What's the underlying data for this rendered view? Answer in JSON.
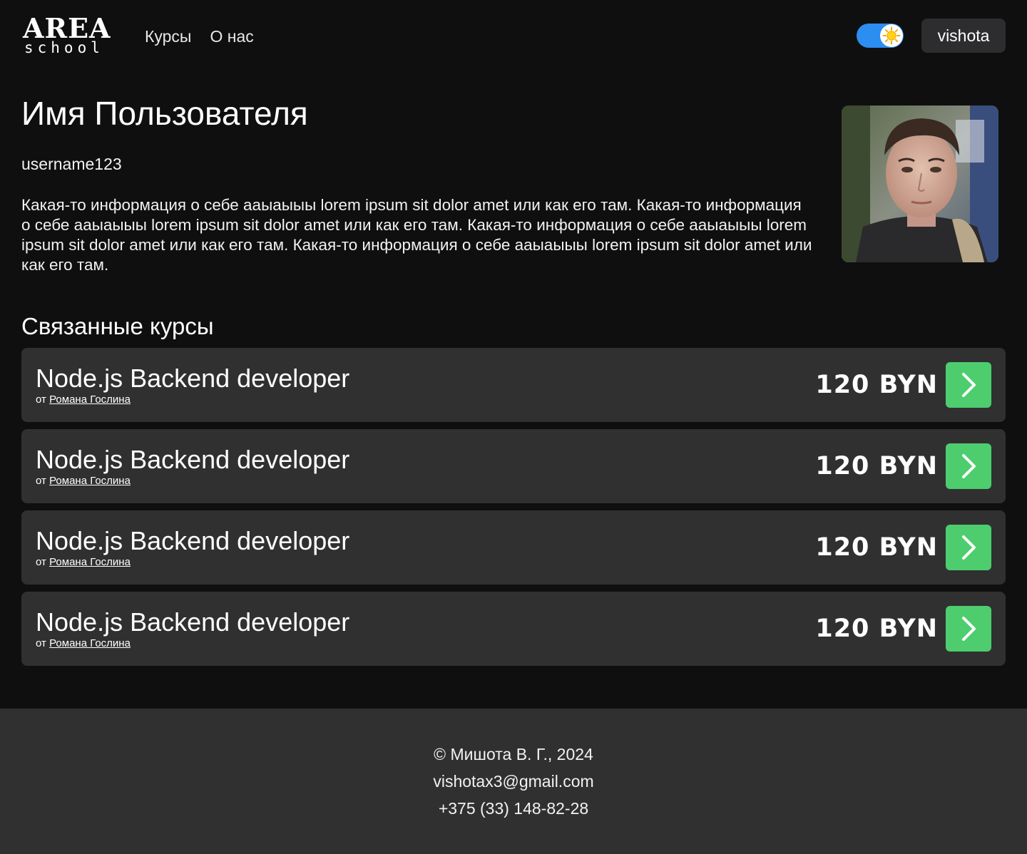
{
  "header": {
    "logo": {
      "line1": "AREA",
      "line2": "school"
    },
    "nav": [
      {
        "label": "Курсы"
      },
      {
        "label": "О нас"
      }
    ],
    "theme_toggle": {
      "state": "on",
      "icon": "sun-icon",
      "color": "#2b8ef0"
    },
    "user_button_label": "vishota"
  },
  "profile": {
    "name": "Имя Пользователя",
    "username": "username123",
    "bio": "Какая-то информация о себе ааыаыыы lorem ipsum sit dolor amet или как его там. Какая-то информация о себе ааыаыыы lorem ipsum sit dolor amet или как его там. Какая-то информация о себе ааыаыыы lorem ipsum sit dolor amet или как его там. Какая-то информация о себе ааыаыыы lorem ipsum sit dolor amet или как его там."
  },
  "courses": {
    "title": "Связанные курсы",
    "items": [
      {
        "title": "Node.js Backend developer",
        "author_prefix": "от",
        "author": "Романа Гослина",
        "price": "120 BYN"
      },
      {
        "title": "Node.js Backend developer",
        "author_prefix": "от",
        "author": "Романа Гослина",
        "price": "120 BYN"
      },
      {
        "title": "Node.js Backend developer",
        "author_prefix": "от",
        "author": "Романа Гослина",
        "price": "120 BYN"
      },
      {
        "title": "Node.js Backend developer",
        "author_prefix": "от",
        "author": "Романа Гослина",
        "price": "120 BYN"
      }
    ],
    "open_icon": "chevron-right-icon",
    "accent_color": "#4dcd6e"
  },
  "footer": {
    "copyright": "© Мишота В. Г., 2024",
    "email": "vishotax3@gmail.com",
    "phone": "+375 (33) 148-82-28"
  }
}
